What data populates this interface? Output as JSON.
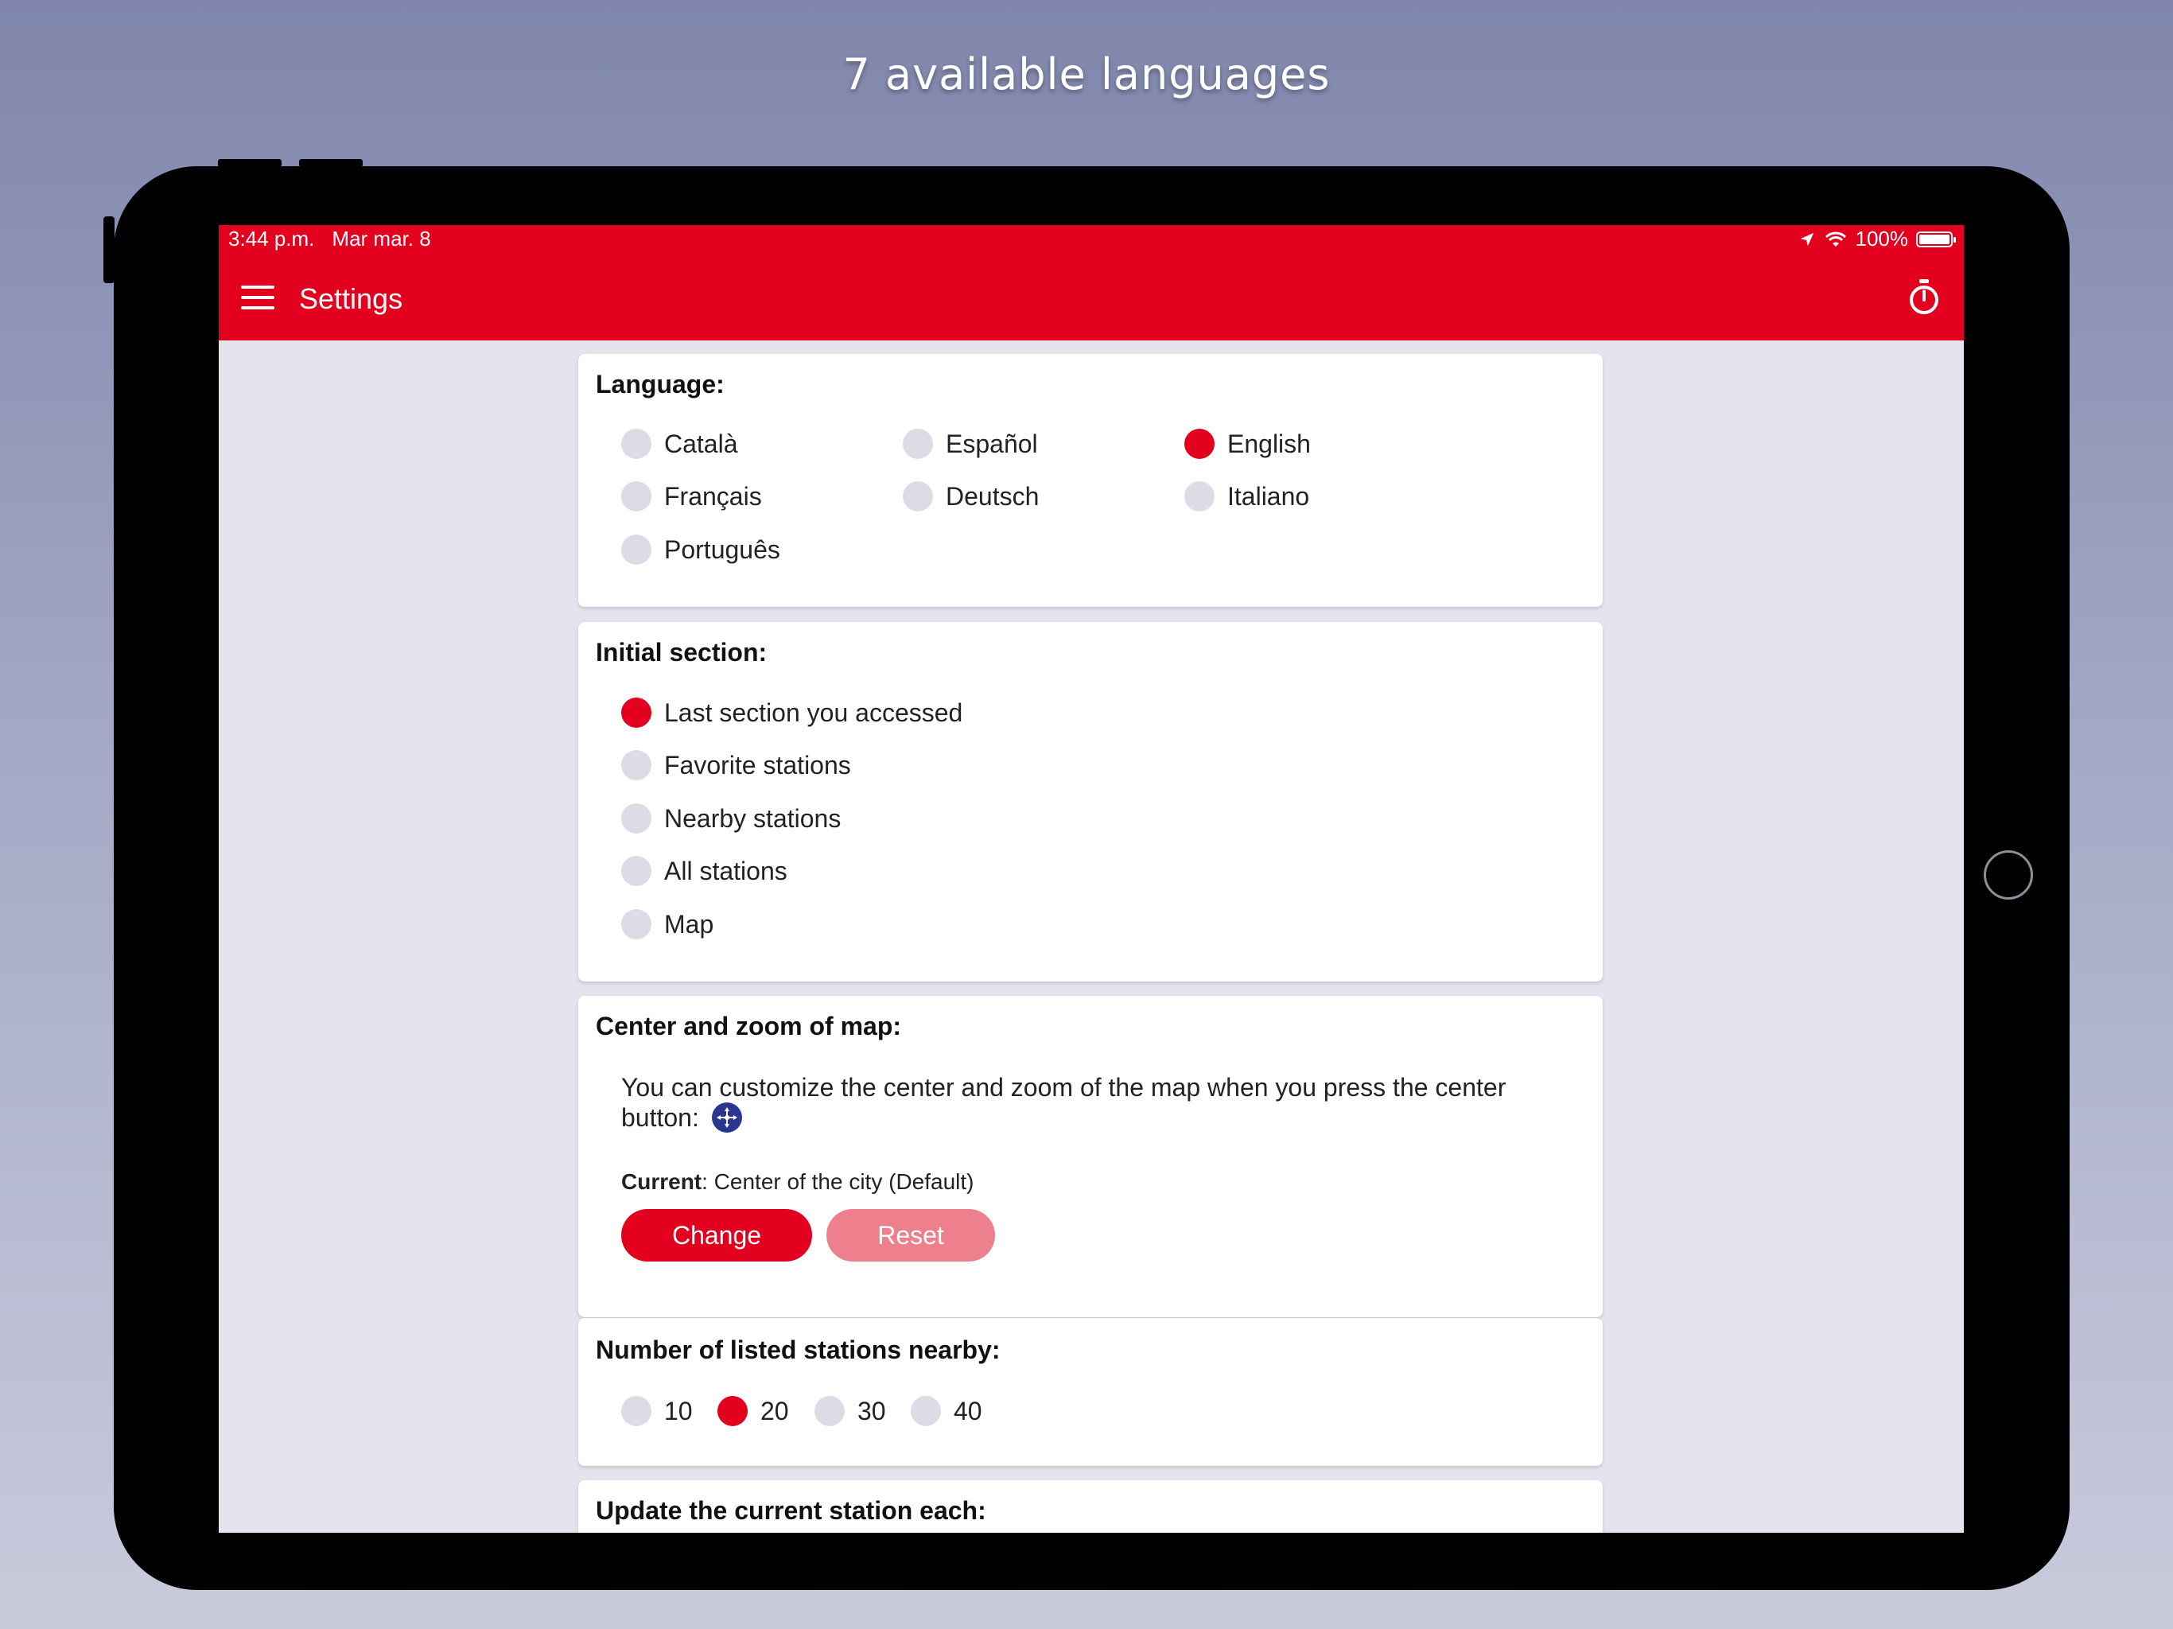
{
  "headline": "7 available languages",
  "colors": {
    "accent": "#e2001e",
    "reset_button": "#ee7f8d",
    "radio_off": "#dcdce6",
    "center_icon": "#2b3690"
  },
  "status_bar": {
    "time": "3:44 p.m.",
    "date": "Mar mar. 8",
    "battery": "100%",
    "icons": [
      "location-arrow-icon",
      "wifi-icon",
      "battery-icon"
    ]
  },
  "app_bar": {
    "title": "Settings",
    "menu_icon": "hamburger-menu-icon",
    "action_icon": "stopwatch-icon"
  },
  "language": {
    "title": "Language:",
    "options": [
      {
        "label": "Català",
        "selected": false
      },
      {
        "label": "Español",
        "selected": false
      },
      {
        "label": "English",
        "selected": true
      },
      {
        "label": "Français",
        "selected": false
      },
      {
        "label": "Deutsch",
        "selected": false
      },
      {
        "label": "Italiano",
        "selected": false
      },
      {
        "label": "Português",
        "selected": false
      }
    ]
  },
  "initial_section": {
    "title": "Initial section:",
    "options": [
      {
        "label": "Last section you accessed",
        "selected": true
      },
      {
        "label": "Favorite stations",
        "selected": false
      },
      {
        "label": "Nearby stations",
        "selected": false
      },
      {
        "label": "All stations",
        "selected": false
      },
      {
        "label": "Map",
        "selected": false
      }
    ]
  },
  "map_center": {
    "title": "Center and zoom of map:",
    "description": "You can customize the center and zoom of the map when you press the center button:",
    "current_label": "Current",
    "current_value": ": Center of the city (Default)",
    "change_button": "Change",
    "reset_button": "Reset"
  },
  "nearby_count": {
    "title": "Number of listed stations nearby:",
    "options": [
      {
        "label": "10",
        "selected": false
      },
      {
        "label": "20",
        "selected": true
      },
      {
        "label": "30",
        "selected": false
      },
      {
        "label": "40",
        "selected": false
      }
    ]
  },
  "update_section": {
    "title": "Update the current station each:"
  }
}
